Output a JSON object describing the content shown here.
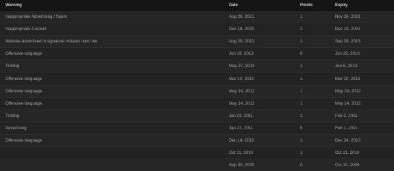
{
  "header": {
    "warning": "Warning",
    "date": "Date",
    "points": "Points",
    "expiry": "Expiry"
  },
  "rows": [
    {
      "warning": "Inappropriate Advertising / Spam",
      "date": "Aug 26, 2021",
      "points": "1",
      "expiry": "Nov 26, 2021"
    },
    {
      "warning": "Inappropriate Content",
      "date": "Dec 18, 2020",
      "points": "1",
      "expiry": "Dec 18, 2021"
    },
    {
      "warning": "Website advertised in signature violates new rule",
      "date": "Aug 29, 2013",
      "points": "1",
      "expiry": "Sep 29, 2013"
    },
    {
      "warning": "Offensive language",
      "date": "Jun 19, 2013",
      "points": "0",
      "expiry": "Jun 29, 2013"
    },
    {
      "warning": "Trolling",
      "date": "May 27, 2013",
      "points": "1",
      "expiry": "Jun 6, 2013"
    },
    {
      "warning": "Offensive language",
      "date": "Mar 10, 2013",
      "points": "1",
      "expiry": "Mar 20, 2013"
    },
    {
      "warning": "Offensive language",
      "date": "May 14, 2012",
      "points": "1",
      "expiry": "May 24, 2012"
    },
    {
      "warning": "Offensive language",
      "date": "May 14, 2012",
      "points": "1",
      "expiry": "May 24, 2012"
    },
    {
      "warning": "Trolling",
      "date": "Jan 23, 2011",
      "points": "1",
      "expiry": "Feb 2, 2011"
    },
    {
      "warning": "Advertising",
      "date": "Jan 22, 2011",
      "points": "0",
      "expiry": "Feb 1, 2011"
    },
    {
      "warning": "Offensive language",
      "date": "Dec 14, 2010",
      "points": "1",
      "expiry": "Dec 24, 2010"
    },
    {
      "warning": "",
      "date": "Oct 11, 2010",
      "points": "1",
      "expiry": "Oct 21, 2010"
    },
    {
      "warning": "",
      "date": "Sep 30, 2009",
      "points": "0",
      "expiry": "Oct 10, 2009"
    }
  ]
}
